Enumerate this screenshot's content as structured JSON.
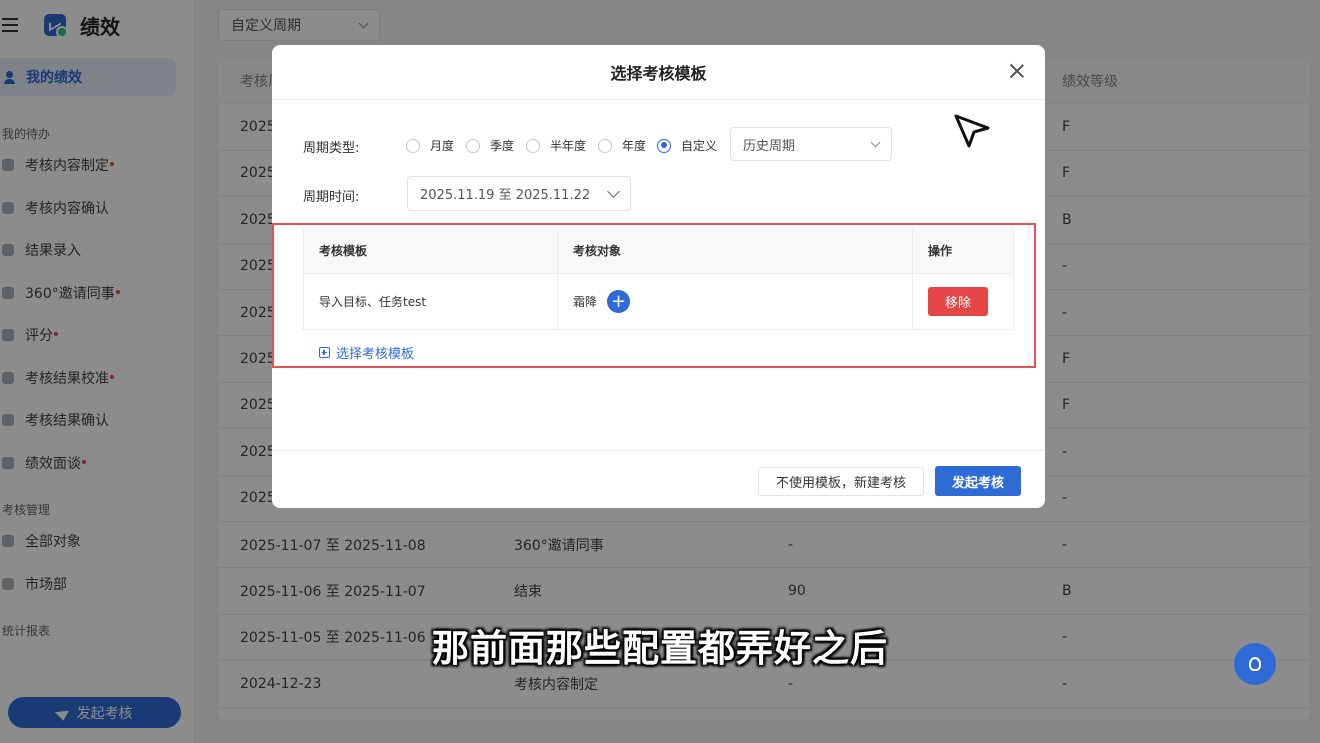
{
  "app": {
    "title": "绩效"
  },
  "sidebar": {
    "active_item": "我的绩效",
    "section_todo": "我的待办",
    "todo_items": [
      {
        "label": "考核内容制定",
        "dot": true
      },
      {
        "label": "考核内容确认",
        "dot": false
      },
      {
        "label": "结果录入",
        "dot": false
      },
      {
        "label": "360°邀请同事",
        "dot": true
      },
      {
        "label": "评分",
        "dot": true
      },
      {
        "label": "考核结果校准",
        "dot": true
      },
      {
        "label": "考核结果确认",
        "dot": false
      },
      {
        "label": "绩效面谈",
        "dot": true
      }
    ],
    "section_manage": "考核管理",
    "manage_items": [
      "全部对象",
      "市场部"
    ],
    "section_stats": "统计报表",
    "bottom_button": "发起考核"
  },
  "toolbar": {
    "period_select": "自定义周期"
  },
  "table": {
    "headers": [
      "考核周",
      "",
      "",
      "绩效等级"
    ],
    "rows": [
      [
        "2025",
        "",
        "",
        "F"
      ],
      [
        "2025",
        "",
        "",
        "F"
      ],
      [
        "2025",
        "",
        "",
        "B"
      ],
      [
        "2025",
        "",
        "",
        "-"
      ],
      [
        "2025",
        "",
        "",
        "-"
      ],
      [
        "2025",
        "",
        "",
        "F"
      ],
      [
        "2025",
        "",
        "",
        "F"
      ],
      [
        "2025",
        "",
        "",
        "-"
      ],
      [
        "2025",
        "",
        "",
        "-"
      ],
      [
        "2025-11-07 至 2025-11-08",
        "360°邀请同事",
        "-",
        "-"
      ],
      [
        "2025-11-06 至 2025-11-07",
        "结束",
        "90",
        "B"
      ],
      [
        "2025-11-05 至 2025-11-06",
        "",
        "",
        "-"
      ],
      [
        "2024-12-23",
        "考核内容制定",
        "-",
        "-"
      ]
    ]
  },
  "modal": {
    "title": "选择考核模板",
    "period_type_label": "周期类型:",
    "period_types": [
      {
        "label": "月度",
        "checked": false
      },
      {
        "label": "季度",
        "checked": false
      },
      {
        "label": "半年度",
        "checked": false
      },
      {
        "label": "年度",
        "checked": false
      },
      {
        "label": "自定义",
        "checked": true
      }
    ],
    "history_select": "历史周期",
    "period_time_label": "周期时间:",
    "period_time_value": "2025.11.19 至 2025.11.22",
    "table_headers": [
      "考核模板",
      "考核对象",
      "操作"
    ],
    "template_row": {
      "template": "导入目标、任务test",
      "target": "霜降",
      "action": "移除"
    },
    "add_template": "选择考核模板",
    "btn_no_template": "不使用模板，新建考核",
    "btn_start": "发起考核"
  },
  "subtitle": "那前面那些配置都弄好之后",
  "colors": {
    "primary": "#2f6bd6",
    "danger": "#e54545",
    "highlight_box": "#e65151"
  }
}
